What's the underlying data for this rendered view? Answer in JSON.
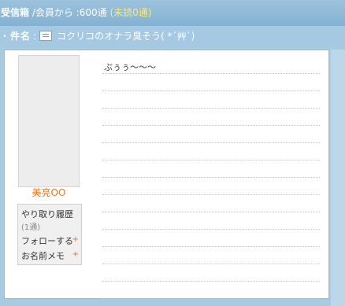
{
  "header": {
    "inbox_title": "受信箱",
    "from_text": " /会員から :600通 ",
    "unread_text": "(未読0通)"
  },
  "subject": {
    "label": "件名",
    "separator": ":",
    "icon": "mail-icon",
    "text": "コクリコのオナラ臭そう( *´艸`)"
  },
  "sender": {
    "name": "美亮OO",
    "avatar_icon": "avatar-placeholder"
  },
  "actions": {
    "history_label": "やり取り履歴",
    "history_count": "(1通)",
    "follow_label": "フォローする",
    "follow_plus": "+",
    "memo_label": "お名前メモ",
    "memo_plus": "+"
  },
  "message": {
    "body": "ぶぅぅ〜〜〜"
  },
  "colors": {
    "header_bg": "#8fb9d8",
    "unread": "#fbeb74",
    "sender_name": "#e07a1f",
    "plus": "#e8702a"
  }
}
